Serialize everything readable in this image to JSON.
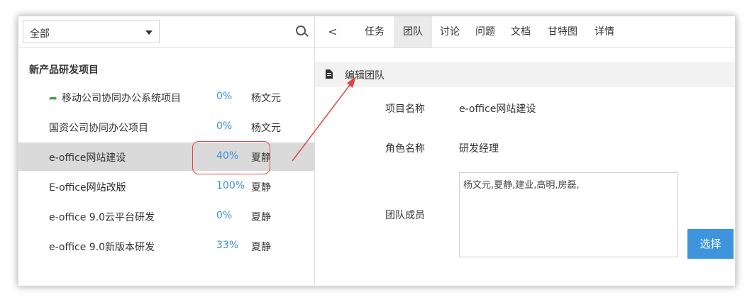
{
  "filter": {
    "selected": "全部"
  },
  "project_group": {
    "title": "新产品研发项目",
    "projects": [
      {
        "name": "移动公司协同办公系统项目",
        "percent": "0%",
        "owner": "杨文元",
        "shared": true
      },
      {
        "name": "国资公司协同办公项目",
        "percent": "0%",
        "owner": "杨文元"
      },
      {
        "name": "e-office网站建设",
        "percent": "40%",
        "owner": "夏静",
        "active": true
      },
      {
        "name": "E-office网站改版",
        "percent": "100%",
        "owner": "夏静"
      },
      {
        "name": "e-office 9.0云平台研发",
        "percent": "0%",
        "owner": "夏静"
      },
      {
        "name": "e-office 9.0新版本研发",
        "percent": "33%",
        "owner": "夏静"
      }
    ]
  },
  "tabs": [
    "任务",
    "团队",
    "讨论",
    "问题",
    "文档",
    "甘特图",
    "详情"
  ],
  "active_tab": "团队",
  "back_glyph": "<",
  "section": {
    "title": "编辑团队"
  },
  "form": {
    "project_name_label": "项目名称",
    "project_name": "e-office网站建设",
    "role_label": "角色名称",
    "role": "研发经理",
    "members_label": "团队成员",
    "members": "杨文元,夏静,建业,高明,房磊,",
    "choose_button": "选择"
  },
  "colors": {
    "accent": "#3e95dd",
    "annotation": "#e04545",
    "percent": "#3b8fd6",
    "share_icon": "#3f9f4f"
  },
  "icons": {
    "filter_caret": "chevron-down-icon",
    "search": "search-icon",
    "back": "chevron-left-icon",
    "section": "document-icon",
    "shared": "share-arrow-icon"
  }
}
